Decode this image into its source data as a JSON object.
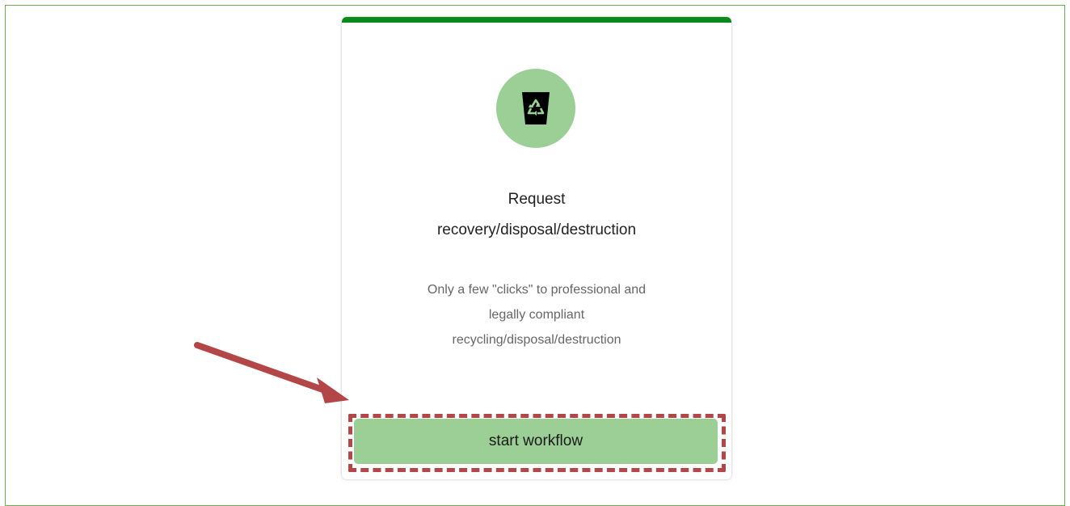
{
  "card": {
    "title_line1": "Request",
    "title_line2": "recovery/disposal/destruction",
    "description_line1": "Only a few \"clicks\" to professional and",
    "description_line2": "legally compliant",
    "description_line3": "recycling/disposal/destruction",
    "icon": "recycle-bin-icon",
    "accent_color": "#0a8a1a",
    "icon_bg_color": "#9ccf96"
  },
  "action": {
    "button_label": "start workflow",
    "button_color": "#9ccf96"
  },
  "annotation": {
    "arrow_color": "#b34747",
    "highlight_color": "#b34747"
  }
}
